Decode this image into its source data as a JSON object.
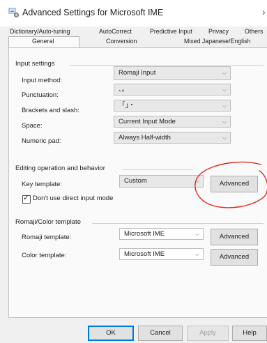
{
  "window": {
    "title": "Advanced Settings for Microsoft IME",
    "close_glyph": "›"
  },
  "tabs": {
    "top_row": [
      "Dictionary/Auto-tuning",
      "AutoCorrect",
      "Predictive Input",
      "Privacy",
      "Others"
    ],
    "bottom_row": [
      "General",
      "Conversion",
      "Mixed Japanese/English"
    ],
    "selected": "General"
  },
  "input_settings": {
    "title": "Input settings",
    "input_method": {
      "label": "Input method:",
      "value": "Romaji Input"
    },
    "punctuation": {
      "label": "Punctuation:",
      "value": "、。"
    },
    "brackets": {
      "label": "Brackets and slash:",
      "value": "「」・"
    },
    "space": {
      "label": "Space:",
      "value": "Current Input Mode"
    },
    "numeric_pad": {
      "label": "Numeric pad:",
      "value": "Always Half-width"
    }
  },
  "editing": {
    "title": "Editing operation and behavior",
    "key_template": {
      "label": "Key template:",
      "value": "Custom",
      "button": "Advanced"
    },
    "direct_input": {
      "label": "Don't use direct input mode",
      "checked": true
    }
  },
  "romaji_color": {
    "title": "Romaji/Color template",
    "romaji": {
      "label": "Romaji template:",
      "value": "Microsoft IME",
      "button": "Advanced"
    },
    "color": {
      "label": "Color template:",
      "value": "Microsoft IME",
      "button": "Advanced"
    }
  },
  "footer": {
    "ok": "OK",
    "cancel": "Cancel",
    "apply": "Apply",
    "help": "Help"
  },
  "annotation_color": "#e0281e"
}
